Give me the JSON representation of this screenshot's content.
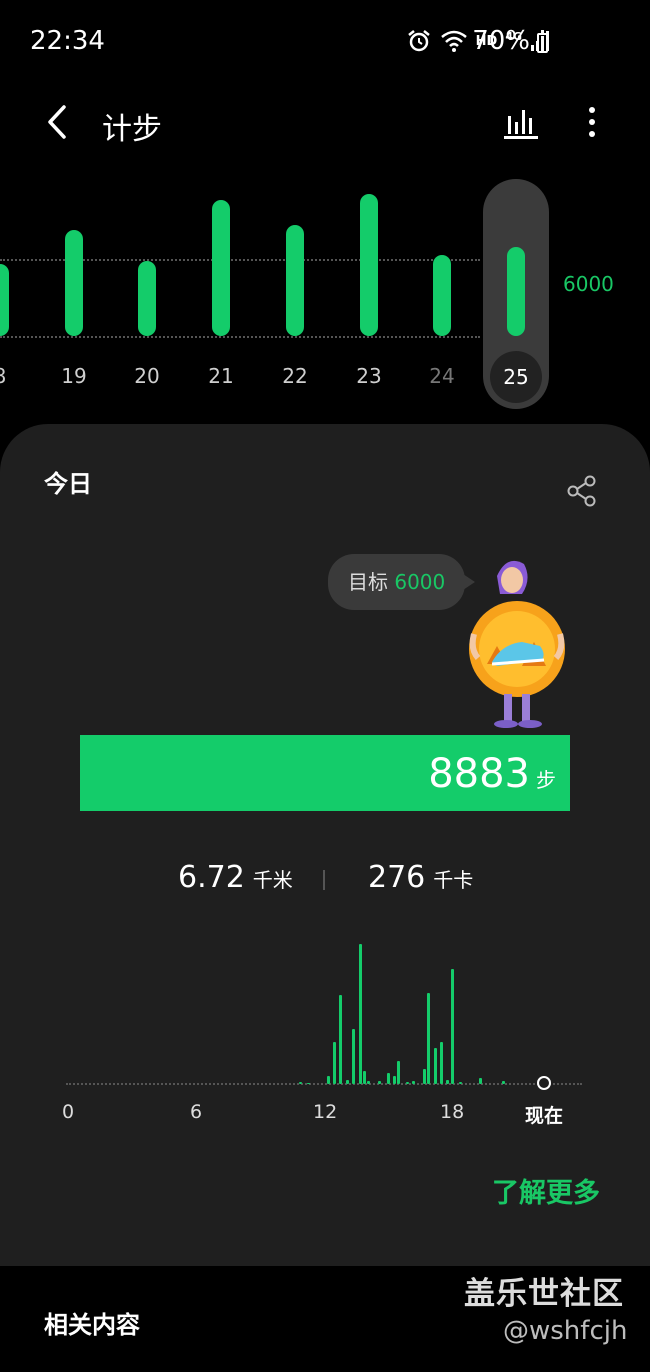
{
  "status_bar": {
    "time": "22:34",
    "network_hd": "HD",
    "network_gen": "4G",
    "battery": "70%"
  },
  "header": {
    "title": "计步"
  },
  "weekly": {
    "goal_label": "6000",
    "days": [
      {
        "label": "8",
        "steps": 5600,
        "state": "edge"
      },
      {
        "label": "19",
        "steps": 8200
      },
      {
        "label": "20",
        "steps": 5800
      },
      {
        "label": "21",
        "steps": 10500
      },
      {
        "label": "22",
        "steps": 8600
      },
      {
        "label": "23",
        "steps": 11000
      },
      {
        "label": "24",
        "steps": 6300,
        "state": "dim"
      },
      {
        "label": "25",
        "steps": 6900,
        "state": "selected"
      }
    ]
  },
  "today": {
    "title": "今日",
    "goal_prefix": "目标",
    "goal_value": "6000",
    "steps": "8883",
    "steps_unit": "步",
    "progress": 1.0,
    "distance": "6.72",
    "distance_unit": "千米",
    "calories": "276",
    "calories_unit": "千卡",
    "hour_labels": [
      "0",
      "6",
      "12",
      "18",
      "现在"
    ],
    "learn_more": "了解更多"
  },
  "chart_data": {
    "type": "bar",
    "x": [
      10.9,
      11.3,
      12.2,
      12.5,
      12.8,
      13.1,
      13.4,
      13.7,
      13.9,
      14.1,
      14.6,
      15.0,
      15.3,
      15.5,
      15.9,
      16.2,
      16.7,
      16.9,
      17.2,
      17.5,
      17.8,
      18.0,
      18.4,
      19.3,
      20.4
    ],
    "values": [
      5,
      3,
      20,
      100,
      210,
      10,
      130,
      330,
      30,
      6,
      8,
      25,
      20,
      55,
      5,
      8,
      35,
      215,
      85,
      100,
      10,
      270,
      4,
      15,
      6
    ],
    "xlim": [
      0,
      21.5
    ]
  },
  "related": {
    "title": "相关内容"
  },
  "watermark": {
    "line1": "盖乐世社区",
    "line2": "@wshfcjh"
  },
  "colors": {
    "accent": "#14cc6a",
    "card": "#1f1f1f",
    "background": "#000000"
  }
}
